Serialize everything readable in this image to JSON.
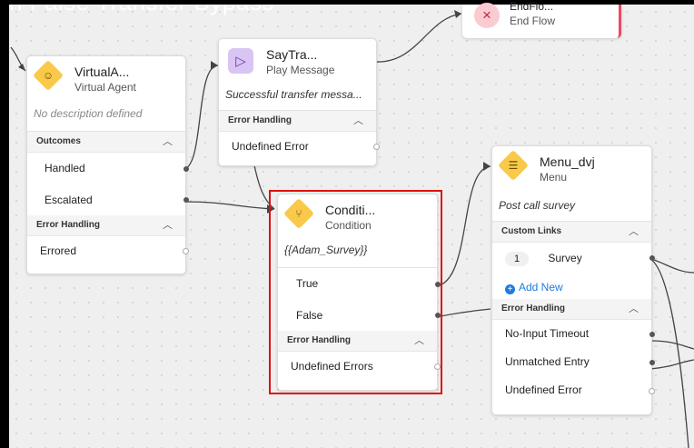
{
  "caption_text": "n False Transfer Bypass",
  "end_flow": {
    "title": "EndFlo...",
    "subtitle": "End Flow"
  },
  "virtual_agent": {
    "title": "VirtualA...",
    "subtitle": "Virtual Agent",
    "description": "No description defined",
    "outcomes_label": "Outcomes",
    "outcomes": [
      "Handled",
      "Escalated"
    ],
    "error_label": "Error Handling",
    "errors": [
      "Errored"
    ]
  },
  "say_transfer": {
    "title": "SayTra...",
    "subtitle": "Play Message",
    "description": "Successful transfer messa...",
    "error_label": "Error Handling",
    "errors": [
      "Undefined Error"
    ]
  },
  "condition": {
    "title": "Conditi...",
    "subtitle": "Condition",
    "description": "{{Adam_Survey}}",
    "outcomes": [
      "True",
      "False"
    ],
    "error_label": "Error Handling",
    "errors": [
      "Undefined Errors"
    ]
  },
  "menu": {
    "title": "Menu_dvj",
    "subtitle": "Menu",
    "description": "Post call survey",
    "links_label": "Custom Links",
    "link_number": "1",
    "link_label": "Survey",
    "add_new": "Add New",
    "error_label": "Error Handling",
    "errors": [
      "No-Input Timeout",
      "Unmatched Entry",
      "Undefined Error"
    ]
  },
  "icons": {
    "collapse": "chevron-up-icon",
    "close": "close-icon",
    "play": "play-icon",
    "condition": "branch-icon",
    "menu": "menu-list-icon",
    "agent": "robot-icon"
  },
  "colors": {
    "selection": "#e01010",
    "end_accent": "#e84a63",
    "diamond": "#f9c94a",
    "link": "#1f7be0"
  }
}
